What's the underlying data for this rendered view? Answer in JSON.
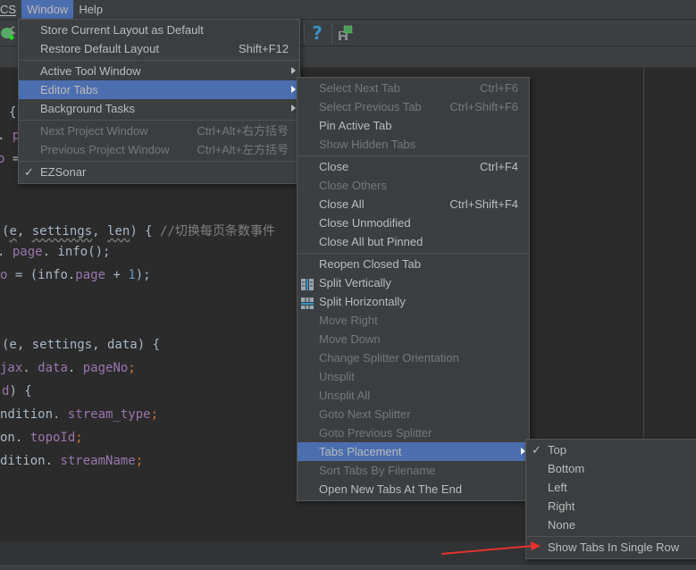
{
  "menubar": {
    "items": [
      {
        "label": "CS"
      },
      {
        "label": "Window"
      },
      {
        "label": "Help"
      }
    ]
  },
  "toolbar": {
    "icons": [
      "bug-icon",
      "help-icon",
      "save-plugin-icon"
    ],
    "help_glyph": "?"
  },
  "editor": {
    "lines": [
      {
        "text": "{"
      },
      {
        "text": ". p"
      },
      {
        "text": "o ="
      },
      {
        "text": "(e, settings, len) { //切换每页条数事件"
      },
      {
        "text": ". page. info();"
      },
      {
        "text": "o = (info.page + 1);"
      },
      {
        "text": "(e, settings, data) {"
      },
      {
        "text": "jax. data. pageNo;"
      },
      {
        "text": "d) {"
      },
      {
        "text": "ndition. stream_type;"
      },
      {
        "text": "on. topoId;"
      },
      {
        "text": "dition. streamName;"
      }
    ],
    "comment": "//切换每页条数事件"
  },
  "window_menu": {
    "items": [
      {
        "label": "Store Current Layout as Default",
        "shortcut": "",
        "disabled": false
      },
      {
        "label": "Restore Default Layout",
        "shortcut": "Shift+F12",
        "disabled": false
      },
      {
        "label": "Active Tool Window",
        "submenu": true
      },
      {
        "label": "Editor Tabs",
        "submenu": true,
        "selected": true
      },
      {
        "label": "Background Tasks",
        "submenu": true
      },
      {
        "label": "Next Project Window",
        "shortcut": "Ctrl+Alt+右方括号",
        "disabled": true
      },
      {
        "label": "Previous Project Window",
        "shortcut": "Ctrl+Alt+左方括号",
        "disabled": true
      },
      {
        "label": "EZSonar",
        "checked": true
      }
    ],
    "check_glyph": "✓"
  },
  "editor_tabs_menu": {
    "items": [
      {
        "label": "Select Next Tab",
        "shortcut": "Ctrl+F6",
        "disabled": true
      },
      {
        "label": "Select Previous Tab",
        "shortcut": "Ctrl+Shift+F6",
        "disabled": true
      },
      {
        "label": "Pin Active Tab",
        "disabled": false
      },
      {
        "label": "Show Hidden Tabs",
        "disabled": true
      },
      {
        "label": "Close",
        "shortcut": "Ctrl+F4",
        "disabled": false
      },
      {
        "label": "Close Others",
        "disabled": true
      },
      {
        "label": "Close All",
        "shortcut": "Ctrl+Shift+F4",
        "disabled": false
      },
      {
        "label": "Close Unmodified",
        "disabled": false
      },
      {
        "label": "Close All but Pinned",
        "disabled": false
      },
      {
        "label": "Reopen Closed Tab",
        "disabled": false
      },
      {
        "label": "Split Vertically",
        "disabled": false,
        "icon": "split-vertically-icon"
      },
      {
        "label": "Split Horizontally",
        "disabled": false,
        "icon": "split-horizontally-icon"
      },
      {
        "label": "Move Right",
        "disabled": true
      },
      {
        "label": "Move Down",
        "disabled": true
      },
      {
        "label": "Change Splitter Orientation",
        "disabled": true
      },
      {
        "label": "Unsplit",
        "disabled": true
      },
      {
        "label": "Unsplit All",
        "disabled": true
      },
      {
        "label": "Goto Next Splitter",
        "disabled": true
      },
      {
        "label": "Goto Previous Splitter",
        "disabled": true
      },
      {
        "label": "Tabs Placement",
        "submenu": true,
        "selected": true
      },
      {
        "label": "Sort Tabs By Filename",
        "disabled": true
      },
      {
        "label": "Open New Tabs At The End",
        "disabled": false
      }
    ]
  },
  "tabs_placement_menu": {
    "items": [
      {
        "label": "Top",
        "checked": true
      },
      {
        "label": "Bottom"
      },
      {
        "label": "Left"
      },
      {
        "label": "Right"
      },
      {
        "label": "None"
      },
      {
        "label": "Show Tabs In Single Row"
      }
    ],
    "check_glyph": "✓"
  },
  "colors": {
    "accent": "#4b6eaf",
    "menu_bg": "#3c3f41",
    "editor_bg": "#2b2b2b",
    "annotation_arrow": "#e8312f"
  }
}
